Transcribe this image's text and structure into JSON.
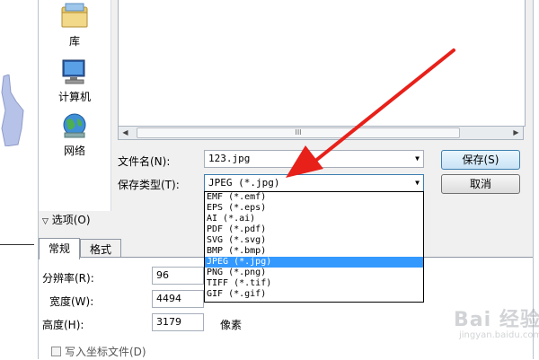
{
  "places": {
    "library_label": "库",
    "computer_label": "计算机",
    "network_label": "网络"
  },
  "file_name": {
    "label": "文件名(N):",
    "value": "123.jpg"
  },
  "save_type": {
    "label": "保存类型(T):",
    "value": "JPEG (*.jpg)"
  },
  "buttons": {
    "save": "保存(S)",
    "cancel": "取消"
  },
  "scrollbar": {
    "grip": "III"
  },
  "dropdown": {
    "options": [
      "EMF (*.emf)",
      "EPS (*.eps)",
      "AI (*.ai)",
      "PDF (*.pdf)",
      "SVG (*.svg)",
      "BMP (*.bmp)",
      "JPEG (*.jpg)",
      "PNG (*.png)",
      "TIFF (*.tif)",
      "GIF (*.gif)"
    ],
    "selected_index": 6
  },
  "options_section": {
    "toggle_label": "选项(O)",
    "tabs": [
      "常规",
      "格式"
    ],
    "resolution_label": "分辨率(R):",
    "resolution_value": "96",
    "width_label": "宽度(W):",
    "width_value": "4494",
    "height_label": "高度(H):",
    "height_value": "3179",
    "height_unit": "像素",
    "world_file_label": "写入坐标文件(D)"
  },
  "watermark": {
    "main": "Bai 经验",
    "url": "jingyan.baidu.com"
  },
  "colors": {
    "arrow": "#e8201a",
    "selection": "#3399ff",
    "left_shape": "#b7c2e8"
  }
}
